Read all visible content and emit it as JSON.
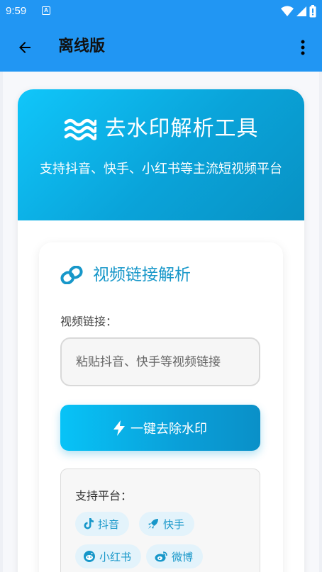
{
  "status_bar": {
    "time": "9:59",
    "notification_glyph": "A"
  },
  "app_bar": {
    "title": "离线版",
    "back_icon": "arrow-left-icon",
    "more_icon": "more-vert-icon"
  },
  "hero": {
    "title": "去水印解析工具",
    "subtitle": "支持抖音、快手、小红书等主流短视频平台",
    "icon": "waves-icon"
  },
  "parser": {
    "section_title": "视频链接解析",
    "section_icon": "link-icon",
    "field_label": "视频链接：",
    "input_placeholder": "粘贴抖音、快手等视频链接",
    "input_value": "",
    "button_label": "一键去除水印",
    "button_icon": "bolt-icon"
  },
  "platforms": {
    "label": "支持平台：",
    "items": [
      {
        "label": "抖音",
        "icon": "tiktok-icon"
      },
      {
        "label": "快手",
        "icon": "rocket-icon"
      },
      {
        "label": "小红书",
        "icon": "reddit-icon"
      },
      {
        "label": "微博",
        "icon": "weibo-icon"
      }
    ]
  },
  "colors": {
    "primary": "#2196f3",
    "accent": "#1797c9",
    "chip_bg": "#e3f3fb"
  }
}
